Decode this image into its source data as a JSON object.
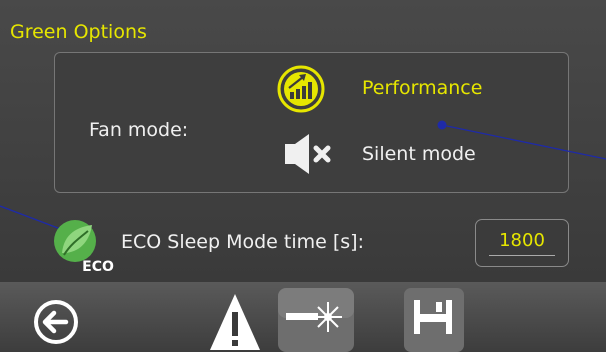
{
  "header": {
    "title": "Green Options"
  },
  "fan_mode": {
    "label": "Fan mode:",
    "options": [
      {
        "label": "Performance",
        "icon": "performance-gauge-icon",
        "selected": true
      },
      {
        "label": "Silent mode",
        "icon": "speaker-mute-icon",
        "selected": false
      }
    ]
  },
  "eco": {
    "label": "ECO Sleep Mode time [s]:",
    "value": "1800",
    "icon_text": "ECO"
  },
  "toolbar": {
    "buttons": [
      {
        "name": "back",
        "icon": "back-arrow-icon"
      },
      {
        "name": "warning",
        "icon": "warning-icon"
      },
      {
        "name": "laser",
        "icon": "laser-icon"
      },
      {
        "name": "save",
        "icon": "floppy-save-icon"
      }
    ]
  },
  "colors": {
    "accent": "#e6e600",
    "panel": "#424242",
    "text": "#f0f0f0",
    "eco_green": "#55b04a"
  }
}
